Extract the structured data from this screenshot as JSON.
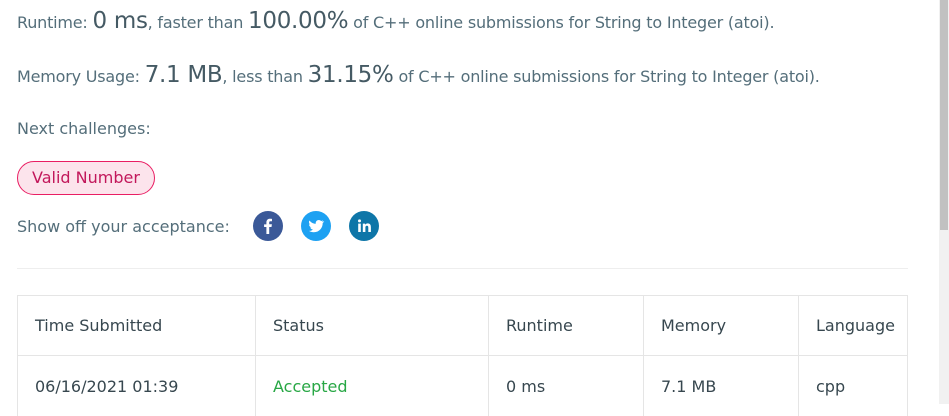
{
  "stats": {
    "runtime": {
      "label": "Runtime: ",
      "value": "0 ms",
      "comparison": ", faster than ",
      "percent": "100.00%",
      "suffix": " of C++ online submissions for String to Integer (atoi)."
    },
    "memory": {
      "label": "Memory Usage: ",
      "value": "7.1 MB",
      "comparison": ", less than ",
      "percent": "31.15%",
      "suffix": " of C++ online submissions for String to Integer (atoi)."
    }
  },
  "next_challenges": {
    "label": "Next challenges:",
    "items": [
      "Valid Number"
    ]
  },
  "share": {
    "label": "Show off your acceptance:",
    "icons": [
      "facebook-icon",
      "twitter-icon",
      "linkedin-icon"
    ]
  },
  "submissions": {
    "columns": [
      "Time Submitted",
      "Status",
      "Runtime",
      "Memory",
      "Language"
    ],
    "rows": [
      {
        "time": "06/16/2021 01:39",
        "status": "Accepted",
        "runtime": "0 ms",
        "memory": "7.1 MB",
        "language": "cpp"
      }
    ]
  },
  "colors": {
    "accepted": "#28a745",
    "tag_border": "#e91e63",
    "tag_bg": "#fce4ec",
    "facebook": "#3b5998",
    "twitter": "#1da1f2",
    "linkedin": "#0e76a8"
  }
}
